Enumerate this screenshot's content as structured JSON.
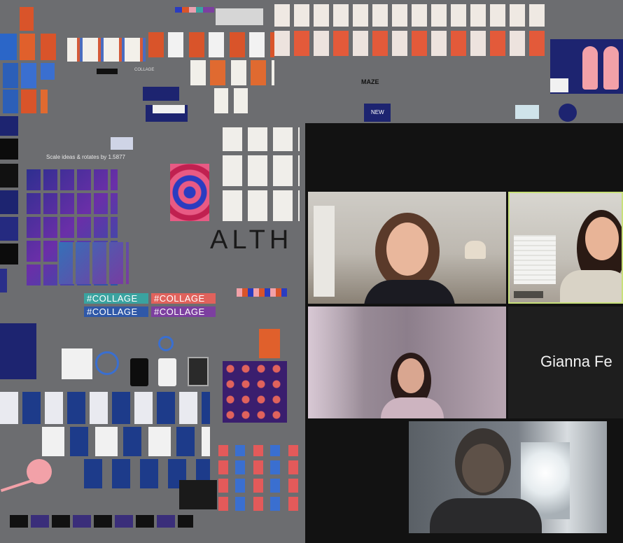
{
  "canvas": {
    "note_text": "Scale ideas & rotates by 1.5877",
    "big_wordmark": "ALTH",
    "small_caption_1": "COLLAGE",
    "small_caption_2": "MAZE",
    "badge_text": "NEW",
    "collage_chips": [
      {
        "label": "#COLLAGE",
        "color": "#3aa3a0"
      },
      {
        "label": "#COLLAGE",
        "color": "#e0625c"
      },
      {
        "label": "#COLLAGE",
        "color": "#2f58a8"
      },
      {
        "label": "#COLLAGE",
        "color": "#7c3fa0"
      }
    ]
  },
  "video_call": {
    "participants": [
      {
        "id": "p1",
        "state": "camera-on"
      },
      {
        "id": "p2",
        "state": "camera-on",
        "active_speaker": true
      },
      {
        "id": "p3",
        "state": "camera-on"
      },
      {
        "id": "p4",
        "state": "camera-off",
        "display_name": "Gianna Fe"
      },
      {
        "id": "p5",
        "state": "camera-on"
      }
    ]
  },
  "colors": {
    "canvas_bg": "#6c6d70",
    "call_bg": "#121212",
    "active_speaker_border": "#c8e07a",
    "accent_orange": "#d9542a",
    "accent_navy": "#1d2470",
    "accent_pink": "#f2a1a8"
  }
}
